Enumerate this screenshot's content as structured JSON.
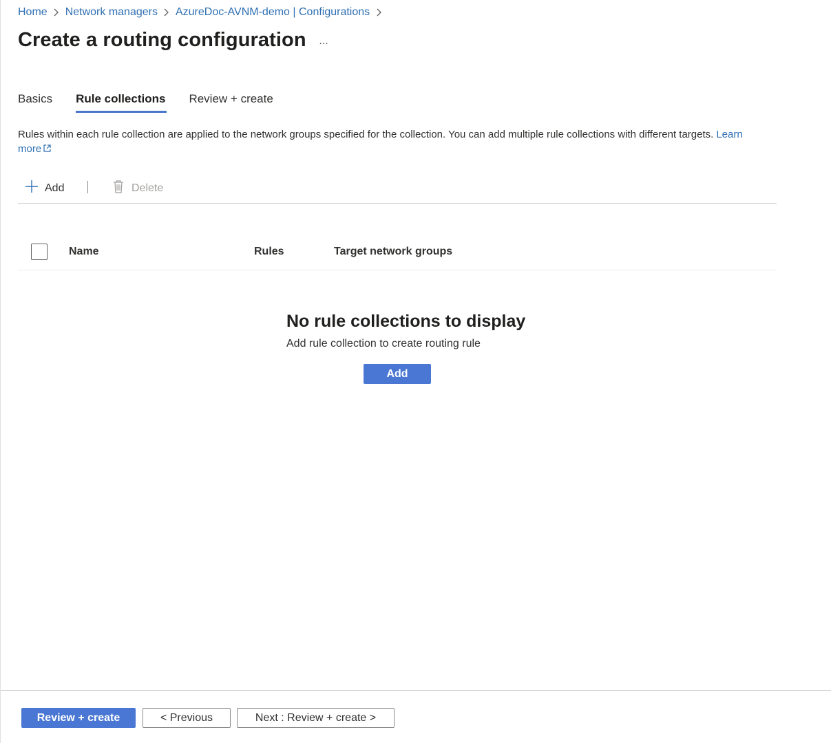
{
  "breadcrumb": {
    "items": [
      "Home",
      "Network managers",
      "AzureDoc-AVNM-demo | Configurations"
    ]
  },
  "page": {
    "title": "Create a routing configuration",
    "more_label": "..."
  },
  "tabs": [
    {
      "label": "Basics",
      "active": false
    },
    {
      "label": "Rule collections",
      "active": true
    },
    {
      "label": "Review + create",
      "active": false
    }
  ],
  "description": {
    "text": "Rules within each rule collection are applied to the network groups specified for the collection. You can add multiple rule collections with different targets.",
    "learn_more": "Learn more"
  },
  "toolbar": {
    "add_label": "Add",
    "delete_label": "Delete"
  },
  "table": {
    "columns": [
      "Name",
      "Rules",
      "Target network groups"
    ]
  },
  "empty_state": {
    "title": "No rule collections to display",
    "subtitle": "Add rule collection to create routing rule",
    "add_button": "Add"
  },
  "footer": {
    "review_create": "Review + create",
    "previous": "< Previous",
    "next": "Next : Review + create >"
  },
  "colors": {
    "accent": "#4a77d4",
    "link": "#2f6fb3"
  },
  "icons": {
    "add": "plus-icon",
    "delete": "trash-icon",
    "external": "external-link-icon",
    "chevron": "chevron-right-icon"
  }
}
